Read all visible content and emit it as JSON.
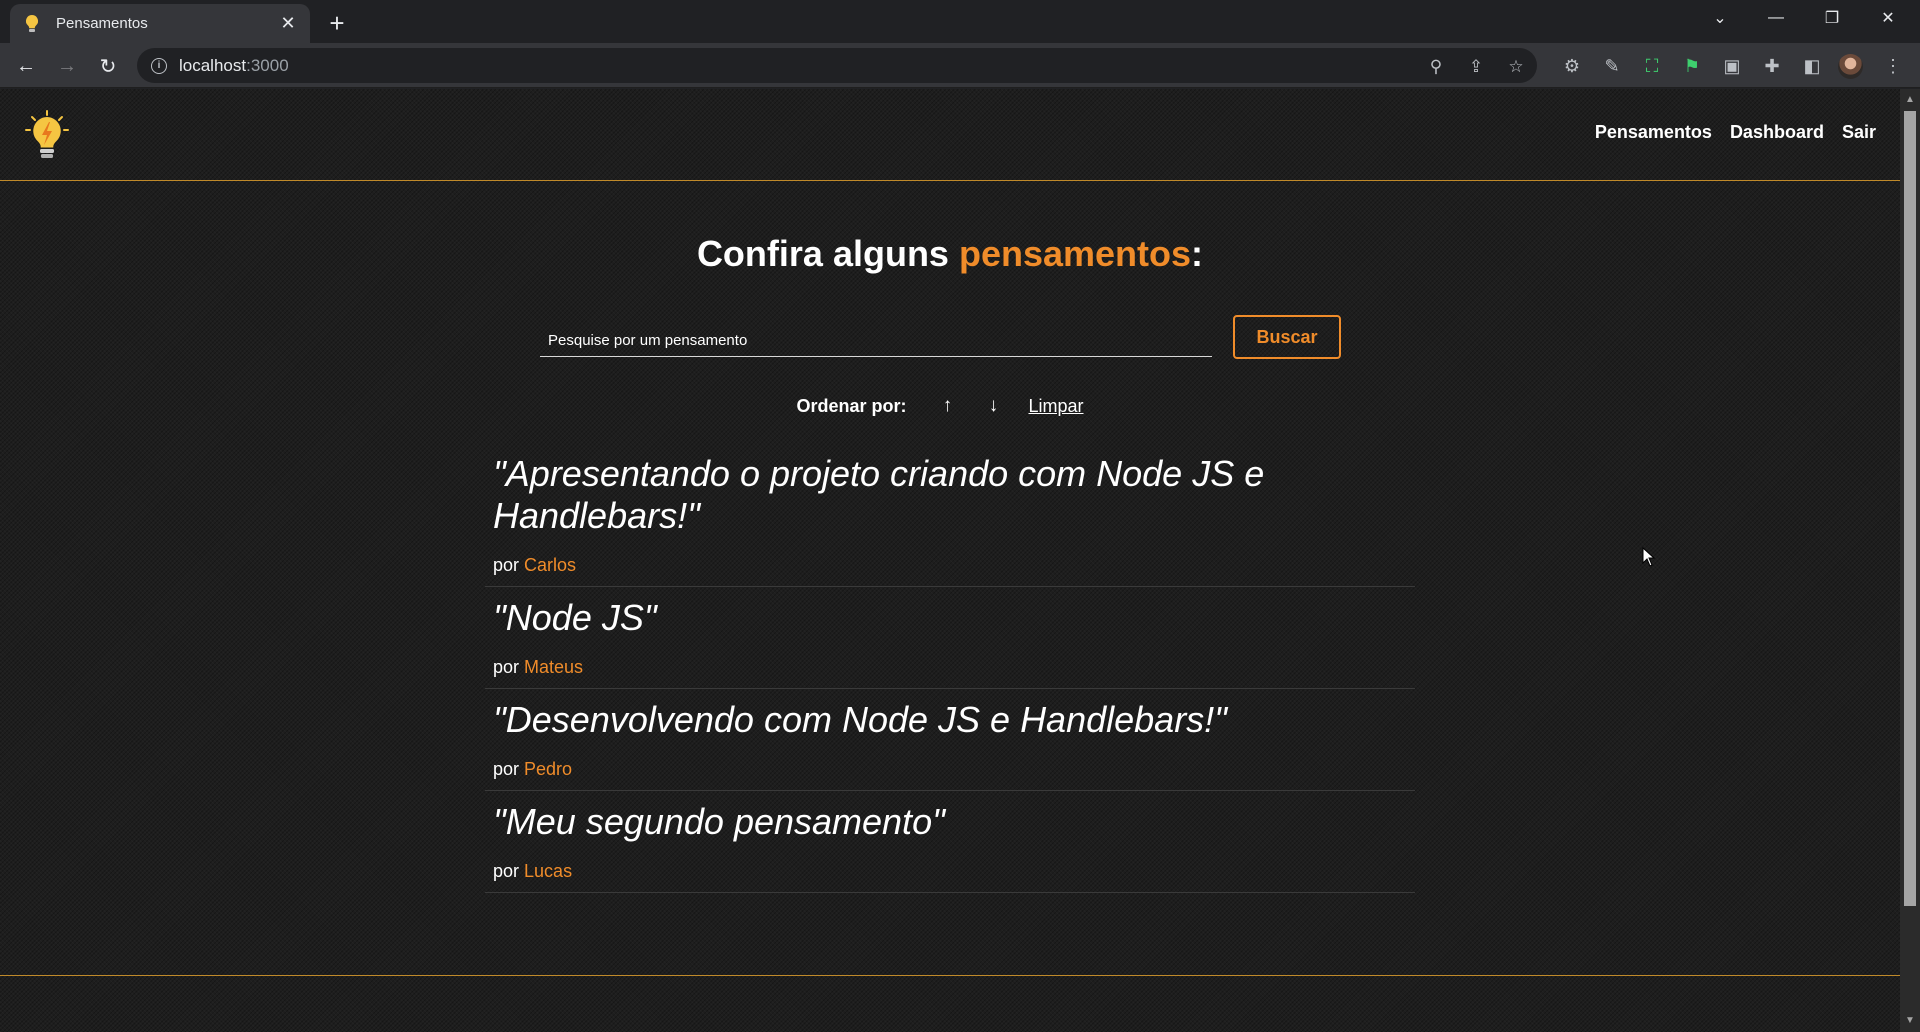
{
  "browser": {
    "tab_title": "Pensamentos",
    "url_host": "localhost",
    "url_port": ":3000"
  },
  "header": {
    "nav": [
      "Pensamentos",
      "Dashboard",
      "Sair"
    ]
  },
  "main": {
    "heading_prefix": "Confira alguns ",
    "heading_accent": "pensamentos",
    "heading_suffix": ":",
    "search_placeholder": "Pesquise por um pensamento",
    "search_button": "Buscar",
    "sort_label": "Ordenar por:",
    "sort_asc": "↑",
    "sort_desc": "↓",
    "sort_clear": "Limpar",
    "by_prefix": "por",
    "thoughts": [
      {
        "quote": "\"Apresentando o projeto criando com Node JS e Handlebars!\"",
        "author": "Carlos"
      },
      {
        "quote": "\"Node JS\"",
        "author": "Mateus"
      },
      {
        "quote": "\"Desenvolvendo com Node JS e Handlebars!\"",
        "author": "Pedro"
      },
      {
        "quote": "\"Meu segundo pensamento\"",
        "author": "Lucas"
      }
    ]
  },
  "colors": {
    "accent": "#f08c2a",
    "border": "#c08a2a",
    "background": "#1e1e1e"
  }
}
